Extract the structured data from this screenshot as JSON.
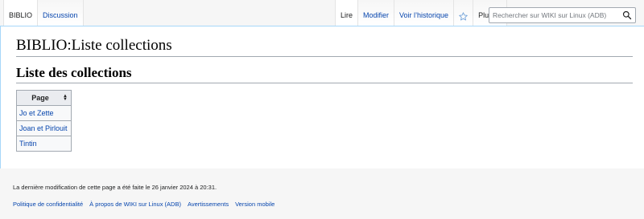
{
  "tabs": {
    "left": [
      {
        "label": "BIBLIO"
      },
      {
        "label": "Discussion"
      }
    ],
    "right": [
      {
        "label": "Lire"
      },
      {
        "label": "Modifier"
      },
      {
        "label": "Voir l’historique"
      },
      {
        "label": "Plus"
      }
    ],
    "star_icon": "star-icon",
    "more_icon": "chevron-down-icon"
  },
  "search": {
    "placeholder": "Rechercher sur WIKI sur Linux (ADB)",
    "icon": "search-icon"
  },
  "page": {
    "title": "BIBLIO:Liste collections",
    "section_heading": "Liste des collections"
  },
  "table": {
    "header": "Page",
    "sort_icon": "sort-icon",
    "rows": [
      {
        "label": "Jo et Zette"
      },
      {
        "label": "Joan et Pirlouit"
      },
      {
        "label": "Tintin"
      }
    ]
  },
  "footer": {
    "last_modified": "La dernière modification de cette page a été faite le 26 janvier 2024 à 20:31.",
    "links": [
      {
        "label": "Politique de confidentialité"
      },
      {
        "label": "À propos de WIKI sur Linux (ADB)"
      },
      {
        "label": "Avertissements"
      },
      {
        "label": "Version mobile"
      }
    ]
  },
  "colors": {
    "link": "#0645ad",
    "border": "#a2a9b1",
    "header_bg": "#eaecf0",
    "footer_bg": "#f6f6f6"
  }
}
